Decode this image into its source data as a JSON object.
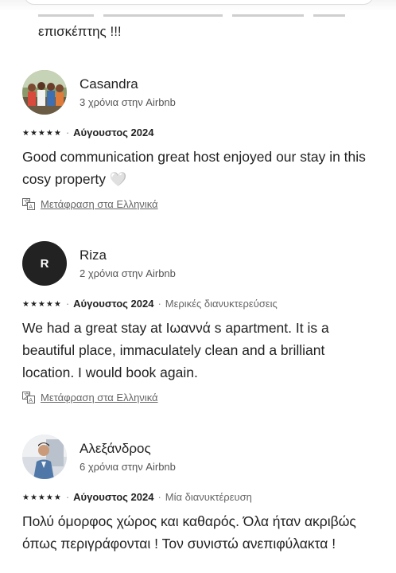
{
  "previous_review": {
    "tail_text": "επισκέπτης !!!"
  },
  "reviews": [
    {
      "name": "Casandra",
      "tenure": "3 χρόνια στην Airbnb",
      "stars": "★★★★★",
      "separator": "·",
      "date": "Αύγουστος 2024",
      "stay_type": "",
      "text": "Good communication great host enjoyed our stay in this cosy property 🤍",
      "translate_label": "Μετάφραση στα Ελληνικά"
    },
    {
      "name": "Riza",
      "avatar_letter": "R",
      "tenure": "2 χρόνια στην Airbnb",
      "stars": "★★★★★",
      "separator": "·",
      "date": "Αύγουστος 2024",
      "stay_type": "Μερικές διανυκτερεύσεις",
      "text": "We had a great stay at Ιωαννά s apartment. It is a beautiful place, immaculately clean and a brilliant location. I would book again.",
      "translate_label": "Μετάφραση στα Ελληνικά"
    },
    {
      "name": "Αλεξάνδρος",
      "tenure": "6 χρόνια στην Airbnb",
      "stars": "★★★★★",
      "separator": "·",
      "date": "Αύγουστος 2024",
      "stay_type": "Μία διανυκτέρευση",
      "text": "Πολύ όμορφος χώρος και καθαρός. Όλα ήταν ακριβώς όπως περιγράφονται ! Τον συνιστώ ανεπιφύλακτα !",
      "translate_label": ""
    }
  ]
}
